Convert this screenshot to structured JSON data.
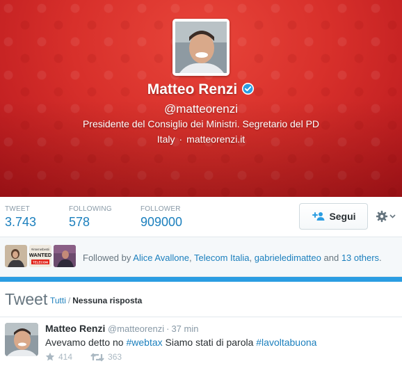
{
  "profile": {
    "name": "Matteo Renzi",
    "handle": "@matteorenzi",
    "bio": "Presidente del Consiglio dei Ministri. Segretario del PD",
    "location": "Italy",
    "separator": "·",
    "website": "matteorenzi.it",
    "verified": true,
    "theme_color": "#d8302b"
  },
  "stats": {
    "tweets_label": "TWEET",
    "tweets_value": "3.743",
    "following_label": "FOLLOWING",
    "following_value": "578",
    "followers_label": "FOLLOWER",
    "followers_value": "909000"
  },
  "actions": {
    "follow_label": "Segui",
    "follow_icon": "add-user-icon",
    "settings_icon": "gear-icon"
  },
  "followed_by": {
    "prefix": "Followed by",
    "users": [
      "Alice Avallone",
      "Telecom Italia",
      "gabrieledimatteo"
    ],
    "comma": ",",
    "conjunction": "and",
    "others": "13 others",
    "suffix": ".",
    "mini_avatar_2_caption_top": "#internetbestii",
    "mini_avatar_2_caption_main": "WANTED",
    "mini_avatar_2_caption_brand": "TELECOM"
  },
  "tweets_section": {
    "title": "Tweet",
    "filter_all": "Tutti",
    "filter_sep": "/",
    "filter_no_replies": "Nessuna risposta"
  },
  "tweet": {
    "author": "Matteo Renzi",
    "handle": "@matteorenzi",
    "dot": "·",
    "time": "37 min",
    "text_part1": "Avevamo detto no ",
    "hashtag1": "#webtax",
    "text_part2": " Siamo stati di parola ",
    "hashtag2": "#lavoltabuona",
    "favorites": "414",
    "retweets": "363"
  },
  "colors": {
    "link": "#1b7fbd",
    "blue_rule": "#2b9de2",
    "verified": "#2b9de2"
  }
}
